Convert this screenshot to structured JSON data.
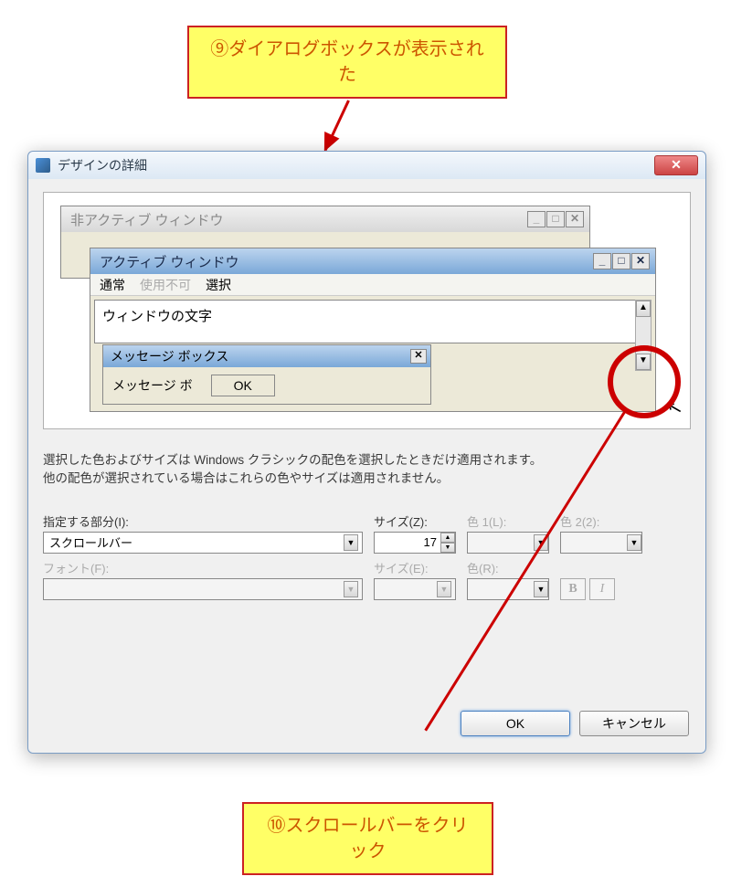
{
  "callouts": {
    "top": "⑨ダイアログボックスが表示された",
    "bottom": "⑩スクロールバーをクリック"
  },
  "dialog": {
    "title": "デザインの詳細",
    "close_x": "✕"
  },
  "preview": {
    "inactive_title": "非アクティブ ウィンドウ",
    "active_title": "アクティブ ウィンドウ",
    "menu": {
      "normal": "通常",
      "disabled": "使用不可",
      "select": "選択"
    },
    "window_text": "ウィンドウの文字",
    "msgbox": {
      "title": "メッセージ ボックス",
      "body": "メッセージ ボ",
      "ok": "OK",
      "close_x": "✕"
    },
    "win_btns": {
      "min": "_",
      "max": "□",
      "close": "✕"
    }
  },
  "desc": {
    "line1": "選択した色およびサイズは Windows クラシックの配色を選択したときだけ適用されます。",
    "line2": "他の配色が選択されている場合はこれらの色やサイズは適用されません。"
  },
  "form": {
    "part_label": "指定する部分(I):",
    "part_value": "スクロールバー",
    "size_z_label": "サイズ(Z):",
    "size_z_value": "17",
    "color1_label": "色 1(L):",
    "color2_label": "色 2(2):",
    "font_label": "フォント(F):",
    "size_e_label": "サイズ(E):",
    "color_r_label": "色(R):",
    "bold": "B",
    "italic": "I"
  },
  "actions": {
    "ok": "OK",
    "cancel": "キャンセル"
  }
}
